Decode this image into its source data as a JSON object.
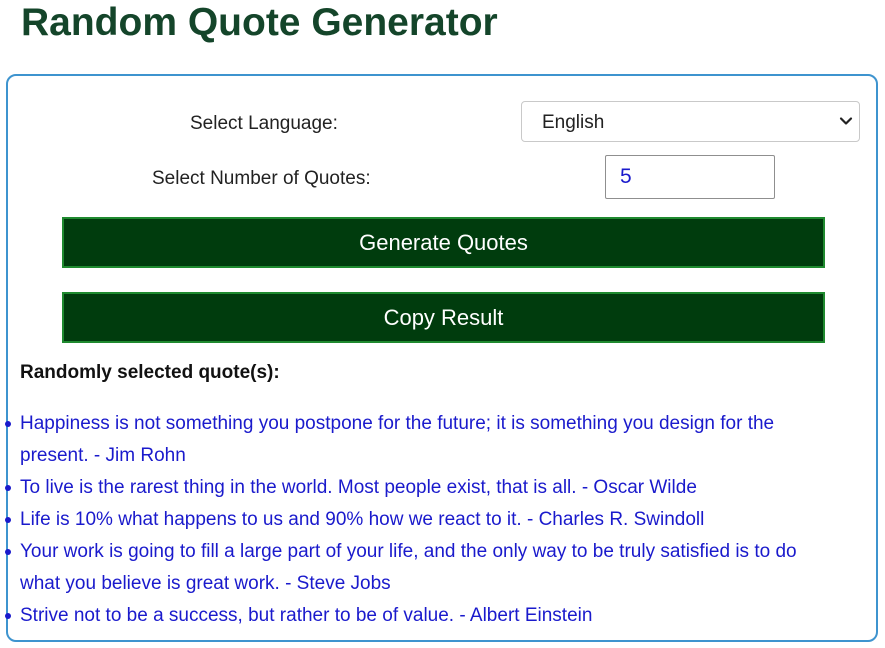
{
  "header": {
    "title": "Random Quote Generator"
  },
  "form": {
    "language_label": "Select Language:",
    "language_selected": "English",
    "quantity_label": "Select Number of Quotes:",
    "quantity_value": "5",
    "generate_label": "Generate Quotes",
    "copy_label": "Copy Result"
  },
  "results": {
    "heading": "Randomly selected quote(s):",
    "quotes": [
      "Happiness is not something you postpone for the future; it is something you design for the present. - Jim Rohn",
      "To live is the rarest thing in the world. Most people exist, that is all. - Oscar Wilde",
      "Life is 10% what happens to us and 90% how we react to it. - Charles R. Swindoll",
      "Your work is going to fill a large part of your life, and the only way to be truly satisfied is to do what you believe is great work. - Steve Jobs",
      "Strive not to be a success, but rather to be of value. - Albert Einstein"
    ]
  },
  "icons": {
    "dropdown": "chevron-down-icon",
    "bullet": "bullet-icon"
  },
  "colors": {
    "title": "#14452a",
    "panel_border": "#3e94cf",
    "button_bg": "#003c0d",
    "button_border": "#1f8a2f",
    "quote_text": "#1a1acc"
  }
}
